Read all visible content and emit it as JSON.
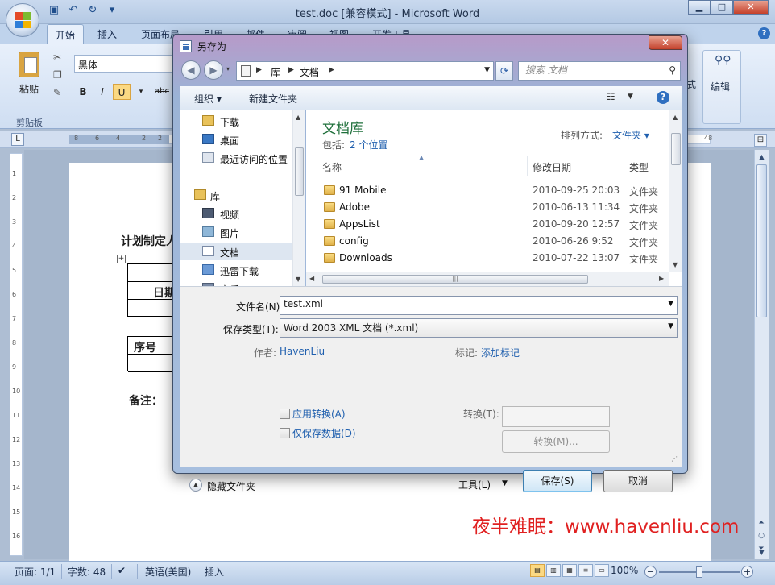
{
  "word": {
    "title": "test.doc [兼容模式] - Microsoft Word",
    "tabs": [
      "开始",
      "插入",
      "页面布局",
      "引用",
      "邮件",
      "审阅",
      "视图",
      "开发工具"
    ],
    "font_name": "黑体",
    "paste_label": "粘贴",
    "clipboard_label": "剪贴板",
    "edit_label": "编辑",
    "style_fragment": "式",
    "ruler_numbers": [
      "8",
      "6",
      "4",
      "2",
      "2",
      "48"
    ],
    "vruler_numbers": [
      "1",
      "2",
      "3",
      "4",
      "5",
      "6",
      "7",
      "8",
      "9",
      "10",
      "11",
      "12",
      "13",
      "14",
      "15",
      "16"
    ],
    "doc": {
      "heading": "计划制定人",
      "date_label": "日期",
      "seq_label": "序号",
      "note_label": "备注："
    },
    "status": {
      "page": "页面: 1/1",
      "words": "字数: 48",
      "language": "英语(美国)",
      "mode": "插入",
      "zoom": "100%",
      "zoom_level": 0.5
    },
    "watermark": "夜半难眠：www.havenliu.com"
  },
  "dialog": {
    "title": "另存为",
    "breadcrumb": [
      "库",
      "文档"
    ],
    "search_placeholder": "搜索 文档",
    "toolbar": {
      "organize": "组织",
      "new_folder": "新建文件夹"
    },
    "nav_items": [
      {
        "label": "下载",
        "icon": "download-folder-icon"
      },
      {
        "label": "桌面",
        "icon": "desktop-icon"
      },
      {
        "label": "最近访问的位置",
        "icon": "recent-places-icon"
      },
      {
        "label": "库",
        "icon": "library-icon"
      },
      {
        "label": "视频",
        "icon": "video-icon"
      },
      {
        "label": "图片",
        "icon": "picture-icon"
      },
      {
        "label": "文档",
        "icon": "document-icon"
      },
      {
        "label": "迅雷下载",
        "icon": "thunder-download-icon"
      },
      {
        "label": "音乐",
        "icon": "music-icon"
      }
    ],
    "library": {
      "title": "文档库",
      "includes_label": "包括:",
      "includes_value": "2 个位置",
      "arrange_label": "排列方式:",
      "arrange_value": "文件夹"
    },
    "columns": [
      "名称",
      "修改日期",
      "类型"
    ],
    "files": [
      {
        "name": "91 Mobile",
        "date": "2010-09-25 20:03",
        "type": "文件夹"
      },
      {
        "name": "Adobe",
        "date": "2010-06-13 11:34",
        "type": "文件夹"
      },
      {
        "name": "AppsList",
        "date": "2010-09-20 12:57",
        "type": "文件夹"
      },
      {
        "name": "config",
        "date": "2010-06-26 9:52",
        "type": "文件夹"
      },
      {
        "name": "Downloads",
        "date": "2010-07-22 13:07",
        "type": "文件夹"
      }
    ],
    "form": {
      "filename_label": "文件名(N):",
      "filename_value": "test.xml",
      "type_label": "保存类型(T):",
      "type_value": "Word 2003 XML 文档 (*.xml)",
      "author_label": "作者:",
      "author_value": "HavenLiu",
      "tags_label": "标记:",
      "tags_value": "添加标记",
      "apply_transform": "应用转换(A)",
      "data_only": "仅保存数据(D)",
      "transform_label": "转换(T):",
      "transform_button": "转换(M)...",
      "hide_folders": "隐藏文件夹",
      "tools": "工具(L)",
      "save": "保存(S)",
      "cancel": "取消"
    }
  }
}
